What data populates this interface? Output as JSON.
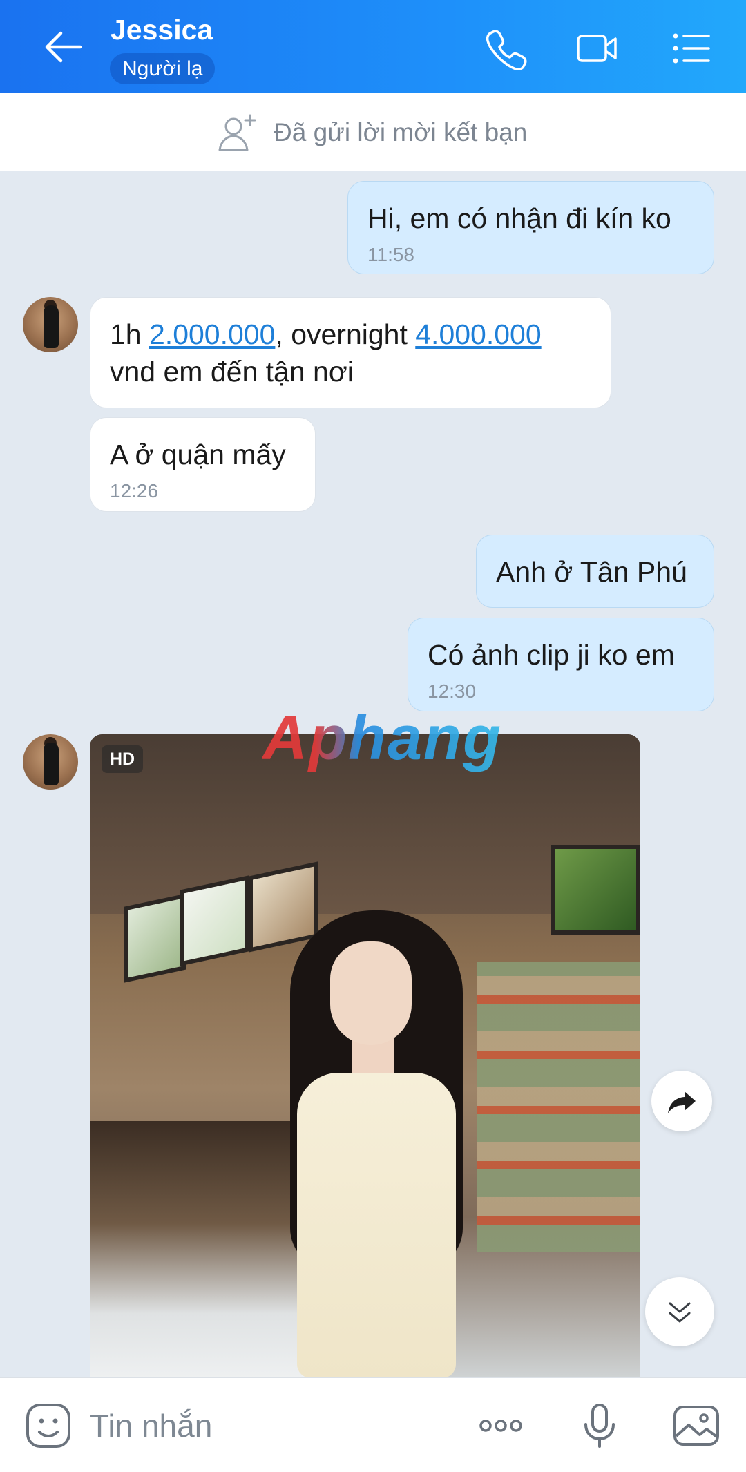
{
  "header": {
    "contact_name": "Jessica",
    "status_badge": "Người lạ",
    "back_icon": "arrow-left-icon",
    "call_icon": "phone-icon",
    "video_icon": "video-camera-icon",
    "menu_icon": "list-menu-icon",
    "gradient_start": "#1a72f0",
    "gradient_end": "#22a8fb"
  },
  "friend_request": {
    "icon": "add-friend-icon",
    "text": "Đã gửi lời mời kết bạn"
  },
  "messages": [
    {
      "sender": "me",
      "text": "Hi, em có nhận đi kín ko",
      "time": "11:58"
    },
    {
      "sender": "them",
      "parts": [
        "1h ",
        "2.000.000",
        ",  overnight ",
        "4.000.000",
        "vnd em đến tận nơi"
      ]
    },
    {
      "sender": "them",
      "text": "A ở quận mấy",
      "time": "12:26"
    },
    {
      "sender": "me",
      "text": "Anh ở Tân Phú"
    },
    {
      "sender": "me",
      "text": "Có ảnh clip ji ko em",
      "time": "12:30"
    },
    {
      "sender": "them",
      "type": "photo",
      "badge": "HD"
    }
  ],
  "watermark": "Aphang",
  "floating": {
    "share_icon": "share-forward-icon",
    "scroll_down_icon": "double-chevron-down-icon"
  },
  "composer": {
    "emoji_icon": "sticker-emoji-icon",
    "placeholder": "Tin nhắn",
    "more_icon": "more-dots-icon",
    "mic_icon": "microphone-icon",
    "image_icon": "image-icon"
  }
}
